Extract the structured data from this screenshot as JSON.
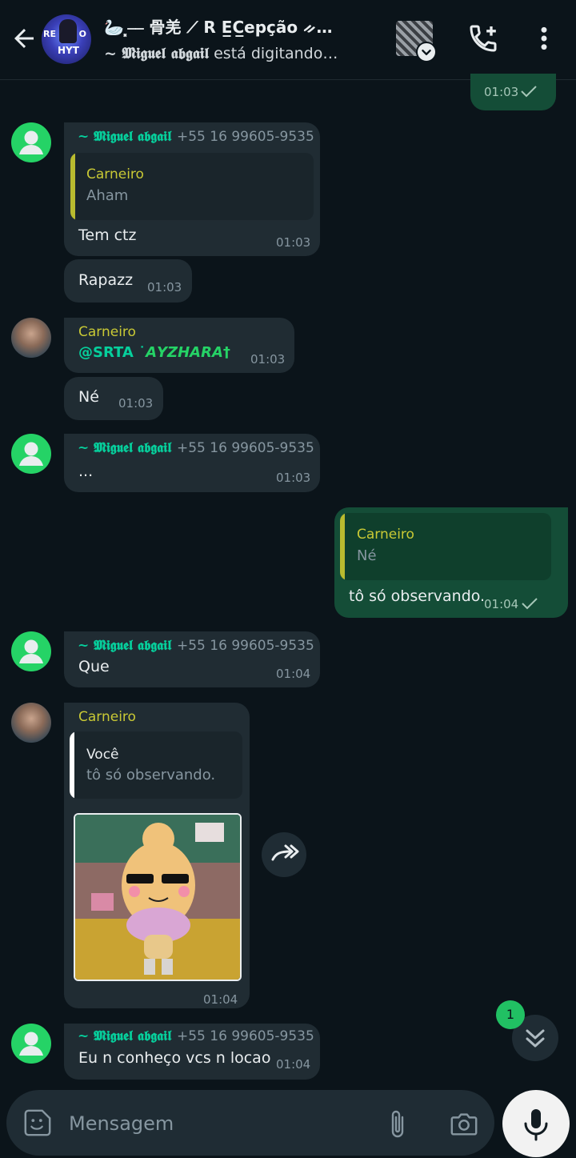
{
  "header": {
    "title": "🦢⸼⎯⎯ 骨羌 ⟋ R E̲C̲epção ᨀ…",
    "typing_user": "~ 𝕸𝖎𝖌𝖚𝖊𝖑 𝖆𝖇𝖌𝖆𝖎𝖑",
    "typing_text": " está digitando…",
    "avatar_text_left": "RE",
    "avatar_text_bottom": "HYT",
    "avatar_text_right": "O"
  },
  "messages": {
    "m0": {
      "time": "01:03"
    },
    "m1": {
      "sender": "~ 𝕸𝖎𝖌𝖚𝖊𝖑 𝖆𝖇𝖌𝖆𝖎𝖑",
      "phone": "+55 16 99605-9535",
      "quote_author": "Carneiro",
      "quote_text": "Aham",
      "text": "Tem ctz",
      "time": "01:03"
    },
    "m2": {
      "text": "Rapazz",
      "time": "01:03"
    },
    "m3": {
      "sender": "Carneiro",
      "mention_at": "@SRTA ˙",
      "mention_name": "𝘼𝙔𝙕𝙃𝘼𝙍𝘼†",
      "time": "01:03"
    },
    "m4": {
      "text": "Né",
      "time": "01:03"
    },
    "m5": {
      "sender": "~ 𝕸𝖎𝖌𝖚𝖊𝖑 𝖆𝖇𝖌𝖆𝖎𝖑",
      "phone": "+55 16 99605-9535",
      "text": "...",
      "time": "01:03"
    },
    "m6": {
      "quote_author": "Carneiro",
      "quote_text": "Né",
      "text": "tô só observando.",
      "time": "01:04"
    },
    "m7": {
      "sender": "~ 𝕸𝖎𝖌𝖚𝖊𝖑 𝖆𝖇𝖌𝖆𝖎𝖑",
      "phone": "+55 16 99605-9535",
      "text": "Que",
      "time": "01:04"
    },
    "m8": {
      "sender": "Carneiro",
      "quote_author": "Você",
      "quote_text": "tô só observando.",
      "time": "01:04"
    },
    "m9": {
      "sender": "~ 𝕸𝖎𝖌𝖚𝖊𝖑 𝖆𝖇𝖌𝖆𝖎𝖑",
      "phone": "+55 16 99605-9535",
      "text": "Eu n conheço vcs n locao",
      "time": "01:04"
    }
  },
  "scroll": {
    "unread_count": "1"
  },
  "composer": {
    "placeholder": "Mensagem"
  },
  "colors": {
    "accent": "#25d366",
    "outgoing": "#144d37",
    "incoming": "#202c33",
    "background": "#0b141a"
  },
  "icons": {
    "back": "arrow-left-icon",
    "call": "add-call-icon",
    "more": "more-vert-icon",
    "emoji": "sticker-emoji-icon",
    "attach": "paperclip-icon",
    "camera": "camera-icon",
    "mic": "mic-icon",
    "forward": "forward-icon",
    "scroll": "double-chevron-down-icon",
    "read": "check-icon"
  }
}
